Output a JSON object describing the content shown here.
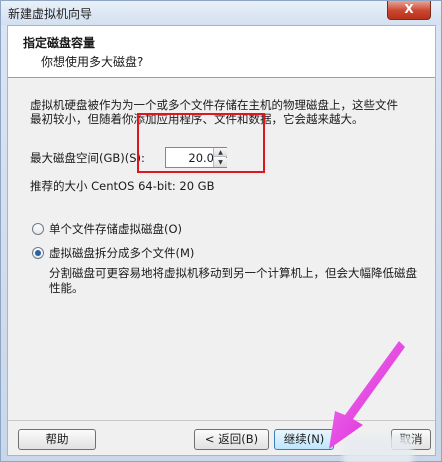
{
  "window": {
    "title": "新建虚拟机向导",
    "close_label": "X"
  },
  "header": {
    "title": "指定磁盘容量",
    "subtitle": "你想使用多大磁盘?"
  },
  "content": {
    "description": "虚拟机硬盘被作为为一个或多个文件存储在主机的物理磁盘上，这些文件最初较小，但随着你添加应用程序、文件和数据，它会越来越大。",
    "max_size_label": "最大磁盘空间(GB)(S):",
    "max_size_value": "20.0",
    "recommended": "推荐的大小 CentOS 64-bit: 20 GB"
  },
  "options": {
    "single_file": {
      "label": "单个文件存储虚拟磁盘(O)",
      "selected": false
    },
    "split_files": {
      "label": "虚拟磁盘拆分成多个文件(M)",
      "selected": true
    },
    "split_description": "分割磁盘可更容易地将虚拟机移动到另一个计算机上，但会大幅降低磁盘性能。"
  },
  "buttons": {
    "help": "帮助",
    "back": "< 返回(B)",
    "next": "继续(N)",
    "cancel": "取消"
  },
  "colors": {
    "highlight_box": "#e0161d",
    "arrow": "#e83ce3"
  }
}
